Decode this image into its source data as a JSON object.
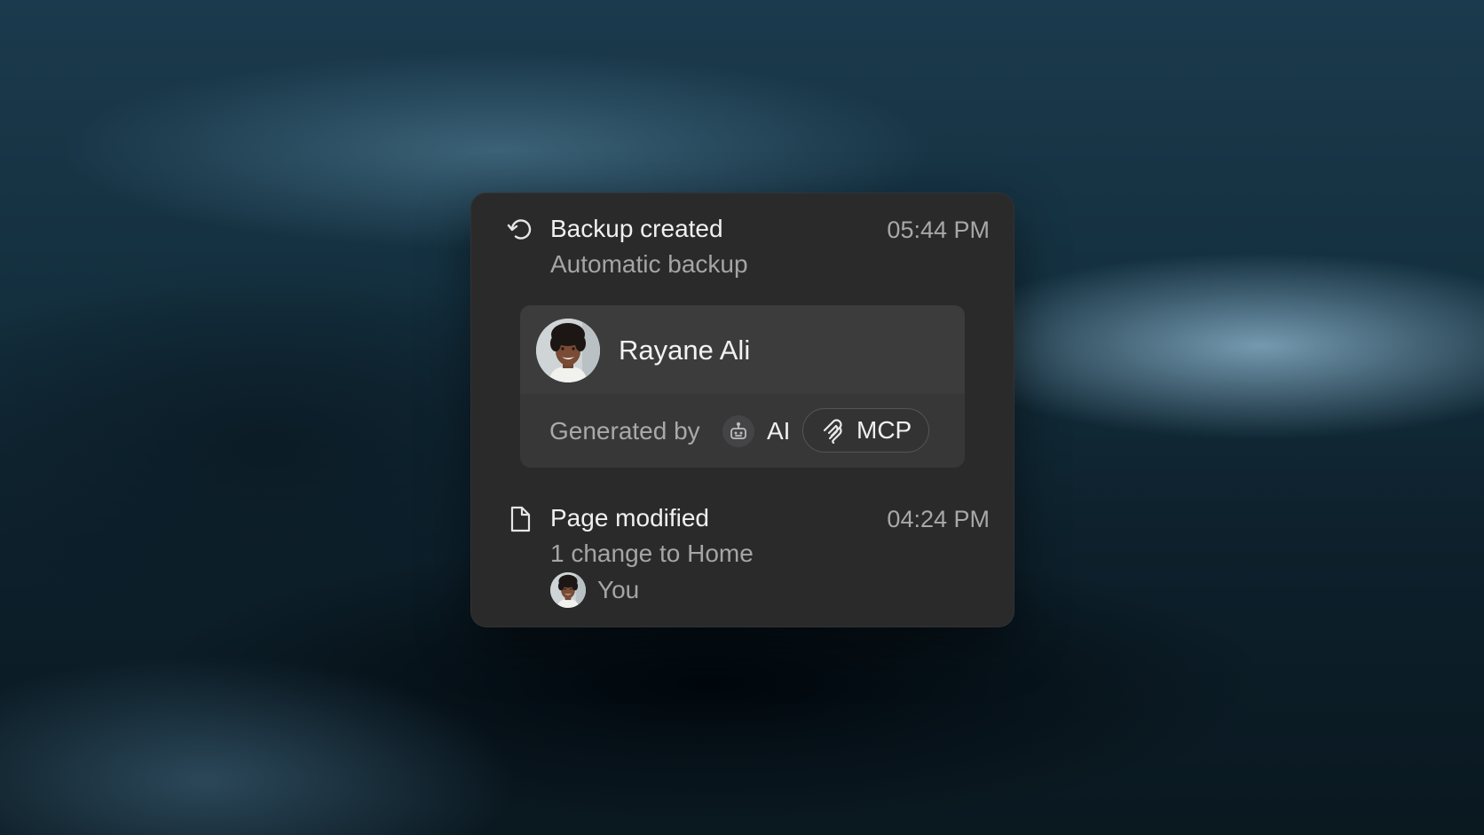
{
  "colors": {
    "panel_bg": "#2a2a2b",
    "card_bg": "#373738",
    "text_primary": "#f0f0f0",
    "text_secondary": "#a5a5a5"
  },
  "activity": [
    {
      "icon": "restore-icon",
      "title": "Backup created",
      "time": "05:44 PM",
      "subtitle": "Automatic backup",
      "user": {
        "name": "Rayane Ali",
        "avatar": "avatar"
      },
      "generated": {
        "label": "Generated by",
        "agent_icon": "robot-icon",
        "agent": "AI",
        "source_icon": "mcp-icon",
        "source": "MCP"
      }
    },
    {
      "icon": "document-icon",
      "title": "Page modified",
      "time": "04:24 PM",
      "subtitle": "1 change to Home",
      "author": "You"
    }
  ]
}
